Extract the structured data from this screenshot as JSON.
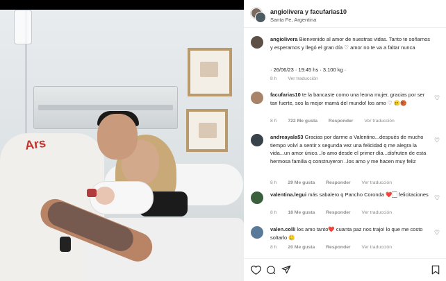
{
  "post": {
    "authors": "angiolivera y facufarias10",
    "location": "Santa Fe, Argentina"
  },
  "caption": {
    "username": "angiolivera",
    "text": "Bienvenido al amor de nuestras vidas. Tanto te soñamos y esperamos y llegó el gran día ♡ amor no te va a faltar nunca",
    "line2": "· 26/06/23 · 19:45 hs · 3.100 kg ·",
    "time": "8 h",
    "translate": "Ver traducción"
  },
  "comments": [
    {
      "username": "facufarias10",
      "text": "te la bancaste como una leona mujer, gracias por ser tan fuerte, sos la mejor mamá del mundo! los amo ♡",
      "emoji_line": "🥲🏀",
      "time": "8 h",
      "likes": "722 Me gusta",
      "reply": "Responder",
      "translate": "Ver traducción"
    },
    {
      "username": "andreayala53",
      "text": "Gracias por darme a Valentino...después de mucho tiempo volví a sentir x segunda vez una felicidad q me alegra la vida...un amor único...lo amo desde el primer día...disfruten de esta hermosa familia q construyeron ..los amo y me hacen muy feliz",
      "time": "8 h",
      "likes": "29 Me gusta",
      "reply": "Responder",
      "translate": "Ver traducción"
    },
    {
      "username": "valentina.legui",
      "text": "más sabalero q Pancho Coronda ❤️🏻 felicitaciones",
      "time": "8 h",
      "likes": "18 Me gusta",
      "reply": "Responder",
      "translate": "Ver traducción"
    },
    {
      "username": "valen.colli",
      "text": "los amo tanto❤️ cuanta paz nos trajo! lo que me costo soltarlo 🥲",
      "time": "8 h",
      "likes": "20 Me gusta",
      "reply": "Responder",
      "translate": "Ver traducción"
    }
  ],
  "actions": {
    "like": "heart-icon",
    "comment": "comment-icon",
    "share": "share-icon",
    "save": "bookmark-icon"
  },
  "photo": {
    "shirt_text": "Ars"
  },
  "colors": {
    "background": "#000000",
    "panel": "#ffffff",
    "text": "#262626",
    "muted": "#8e8e8e"
  }
}
